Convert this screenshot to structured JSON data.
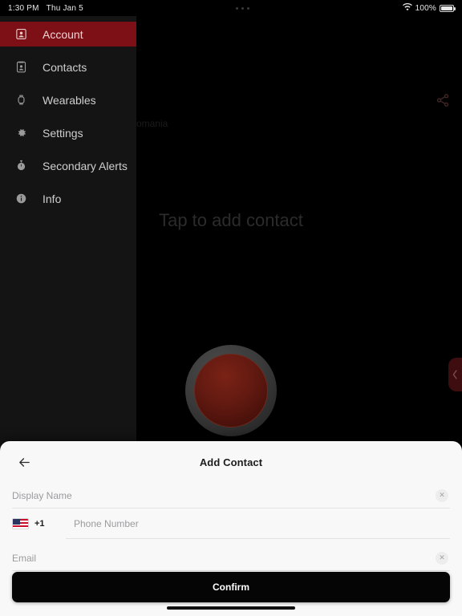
{
  "status_bar": {
    "time": "1:30 PM",
    "date": "Thu Jan 5",
    "battery_percent": "100%",
    "wifi_icon": "wifi-icon",
    "battery_icon": "battery-full-icon",
    "overflow_icon": "ellipsis-icon"
  },
  "sidebar": {
    "background_color": "#141414",
    "active_color": "#7d1016",
    "items": [
      {
        "label": "Account",
        "icon": "account-person-icon",
        "active": true
      },
      {
        "label": "Contacts",
        "icon": "contact-card-icon",
        "active": false
      },
      {
        "label": "Wearables",
        "icon": "watch-icon",
        "active": false
      },
      {
        "label": "Settings",
        "icon": "gear-icon",
        "active": false
      },
      {
        "label": "Secondary Alerts",
        "icon": "stopwatch-icon",
        "active": false
      },
      {
        "label": "Info",
        "icon": "info-circle-icon",
        "active": false
      }
    ]
  },
  "stage": {
    "map_label": "omania",
    "share_icon": "share-icon",
    "tap_hint": "Tap to add contact",
    "panic_button_name": "panic-button",
    "edge_tab_icon": "chevron-left-icon"
  },
  "sheet": {
    "title": "Add Contact",
    "back_icon": "arrow-left-icon",
    "fields": {
      "display_name": {
        "placeholder": "Display Name",
        "value": "",
        "clear_icon": "clear-x-icon"
      },
      "country_code": {
        "flag": "us-flag-icon",
        "code": "+1"
      },
      "phone": {
        "placeholder": "Phone Number",
        "value": ""
      },
      "email": {
        "placeholder": "Email",
        "value": "",
        "clear_icon": "clear-x-icon"
      }
    },
    "confirm_label": "Confirm"
  }
}
